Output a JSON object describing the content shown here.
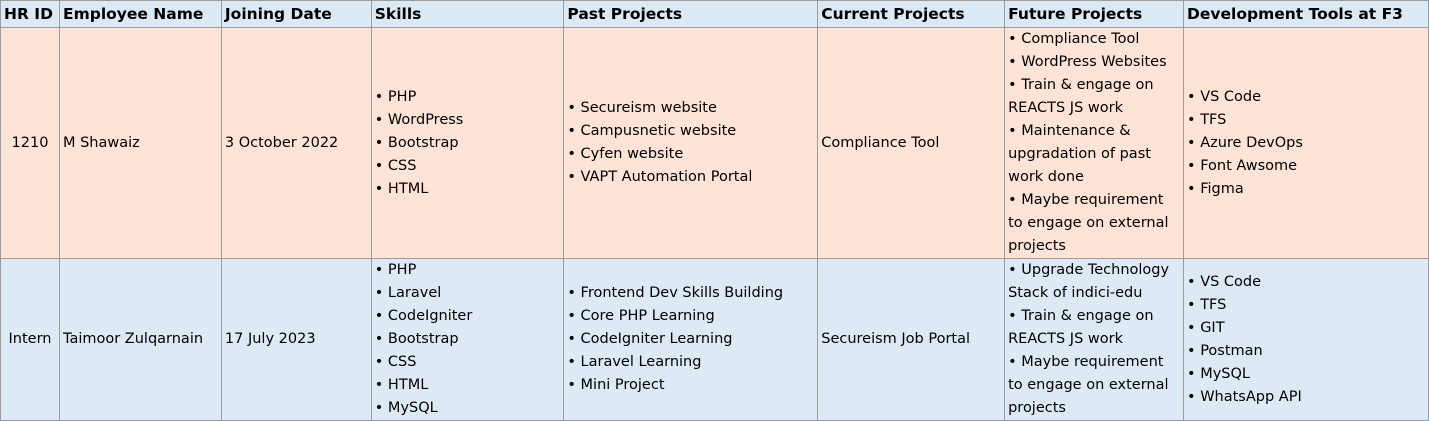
{
  "headers": [
    "HR ID",
    "Employee Name",
    "Joining Date",
    "Skills",
    "Past Projects",
    "Current Projects",
    "Future Projects",
    "Development Tools at F3"
  ],
  "rows": [
    {
      "hr_id": "1210",
      "name": "M Shawaiz",
      "joining_date": "3 October 2022",
      "skills": [
        "• PHP",
        "• WordPress",
        "• Bootstrap",
        "• CSS",
        "• HTML"
      ],
      "past_projects": [
        "• Secureism website",
        "• Campusnetic website",
        "• Cyfen website",
        "• VAPT Automation Portal"
      ],
      "current_projects": "Compliance Tool",
      "future_projects": [
        "• Compliance Tool",
        "• WordPress Websites",
        "• Train & engage on",
        "REACTS JS work",
        "• Maintenance &",
        "upgradation of past",
        "work done",
        "• Maybe requirement",
        "to engage on external",
        "projects"
      ],
      "dev_tools": [
        "• VS Code",
        "• TFS",
        "• Azure DevOps",
        "• Font Awsome",
        "• Figma"
      ]
    },
    {
      "hr_id": "Intern",
      "name": "Taimoor Zulqarnain",
      "joining_date": "17 July 2023",
      "skills": [
        "• PHP",
        "• Laravel",
        "• CodeIgniter",
        "• Bootstrap",
        "• CSS",
        "• HTML",
        "• MySQL"
      ],
      "past_projects": [
        "• Frontend Dev Skills Building",
        "• Core PHP Learning",
        "• CodeIgniter Learning",
        "• Laravel Learning",
        "• Mini Project"
      ],
      "current_projects": "Secureism Job Portal",
      "future_projects": [
        "• Upgrade Technology",
        "Stack of indici-edu",
        "• Train & engage on",
        "REACTS JS work",
        "• Maybe requirement",
        "to engage on external",
        "projects"
      ],
      "dev_tools": [
        "• VS Code",
        "• TFS",
        "• GIT",
        "• Postman",
        "• MySQL",
        "• WhatsApp API"
      ]
    }
  ]
}
